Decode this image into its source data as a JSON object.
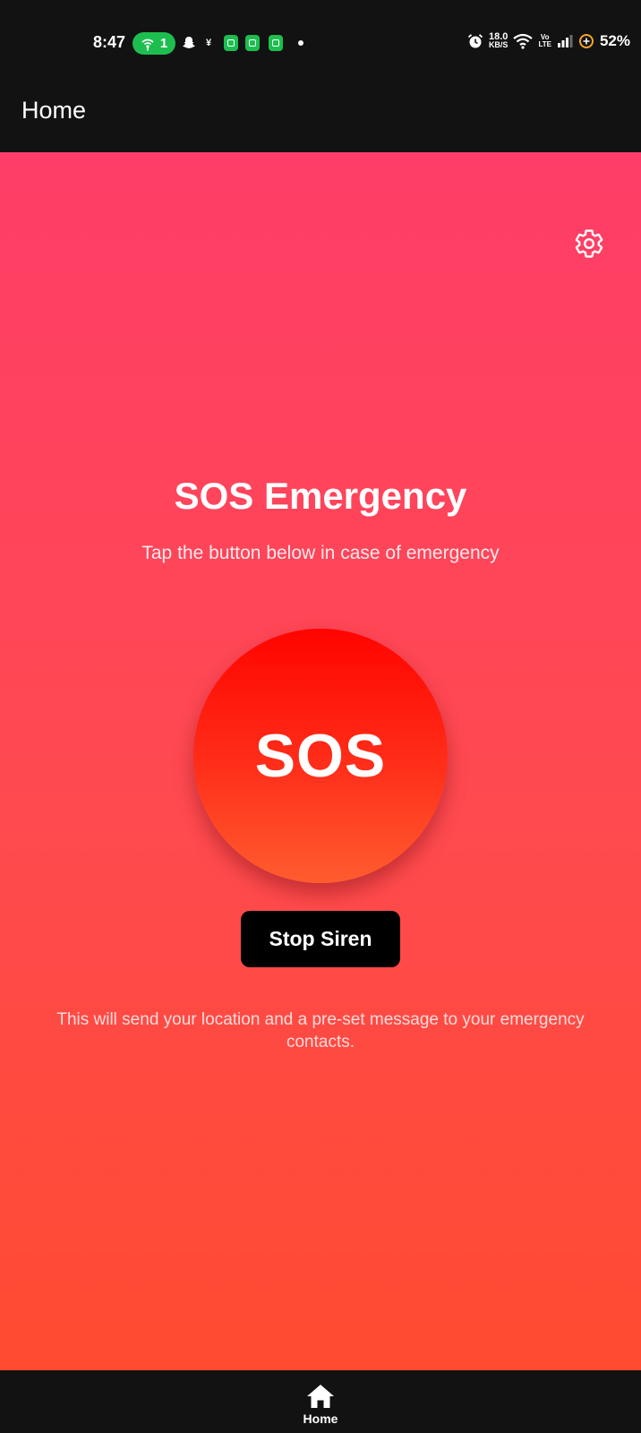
{
  "status_bar": {
    "time": "8:47",
    "hotspot_count": "1",
    "net_speed_value": "18.0",
    "net_speed_unit": "KB/S",
    "volte_top": "Vo",
    "volte_bottom": "LTE",
    "battery": "52%"
  },
  "app_bar": {
    "title": "Home"
  },
  "main": {
    "title": "SOS Emergency",
    "subtitle": "Tap the button below in case of emergency",
    "sos_label": "SOS",
    "stop_siren_label": "Stop Siren",
    "info_text": "This will send your location and a pre-set message to your emergency contacts."
  },
  "bottom_nav": {
    "items": [
      {
        "label": "Home",
        "icon": "home-icon"
      }
    ]
  },
  "colors": {
    "gradient_top": "#ff3d68",
    "gradient_bottom": "#ff4b30",
    "sos_top": "#ff0400",
    "sos_bottom": "#ff5c2e",
    "dark_bar": "#121212",
    "hotspot_green": "#1dbe4f"
  }
}
